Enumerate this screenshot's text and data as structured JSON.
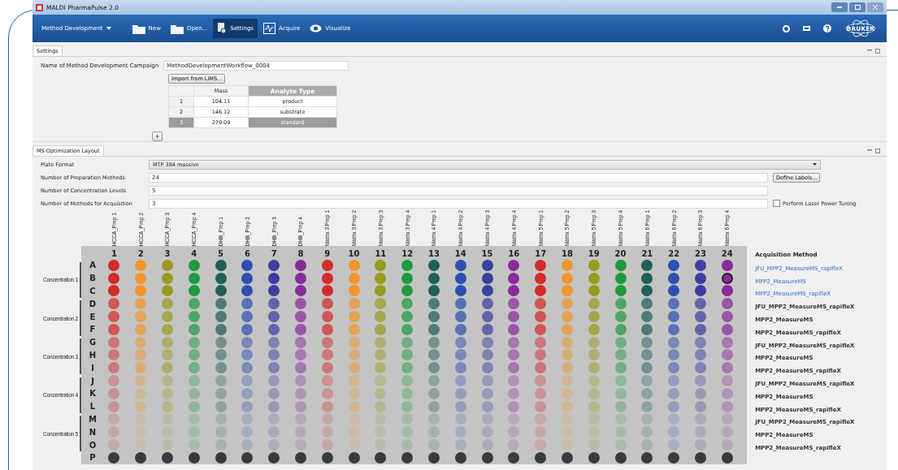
{
  "window": {
    "title": "MALDI PharmaPulse 2.0"
  },
  "toolbar": {
    "items": [
      {
        "label": "Method Development",
        "kind": "dropdown",
        "selected": false
      },
      {
        "label": "New",
        "kind": "folder-new",
        "selected": false
      },
      {
        "label": "Open...",
        "kind": "folder",
        "selected": false
      },
      {
        "label": "Settings",
        "kind": "settings",
        "selected": true
      },
      {
        "label": "Acquire",
        "kind": "acquire",
        "selected": false
      },
      {
        "label": "Visualize",
        "kind": "eye",
        "selected": false
      }
    ],
    "logo_text": "BRUKER"
  },
  "settings": {
    "tab": "Settings",
    "campaign_label": "Name of Method Development Campaign",
    "campaign_value": "MethodDevelopmentWorkflow_0004",
    "import_button": "Import from LIMS...",
    "add_button": "+",
    "analytes": {
      "columns": [
        "Mass",
        "Analyte Type"
      ],
      "rows": [
        {
          "index": "1",
          "mass": "104.11",
          "type": "product",
          "selected": false
        },
        {
          "index": "2",
          "mass": "146.12",
          "type": "substrate",
          "selected": false
        },
        {
          "index": "3",
          "mass": "279.09",
          "type": "standard",
          "selected": true
        }
      ]
    }
  },
  "layout": {
    "tab": "MS Optimization Layout",
    "plate_format_label": "Plate Format",
    "plate_format": "MTP 384 massive",
    "fields": [
      {
        "label": "Number of Preparation Methods",
        "value": "24"
      },
      {
        "label": "Number of Concentration Levels",
        "value": "5"
      },
      {
        "label": "Number of Methods for Acquisition",
        "value": "3"
      }
    ],
    "define_labels_button": "Define Labels...",
    "laser_tuning": {
      "label": "Perform Laser Power Tuning",
      "checked": false
    },
    "plate": {
      "method_heading": "Acquisition Method",
      "columns": [
        {
          "number": "1",
          "label": "HCCA_Prep 1",
          "color": "#d42a2a"
        },
        {
          "number": "2",
          "label": "HCCA_Prep 2",
          "color": "#f0962a"
        },
        {
          "number": "3",
          "label": "HCCA_Prep 3",
          "color": "#9a9a20"
        },
        {
          "number": "4",
          "label": "HCCA_Prep 4",
          "color": "#1f9a3f"
        },
        {
          "number": "5",
          "label": "DHB_Prep 1",
          "color": "#1f5f5a"
        },
        {
          "number": "6",
          "label": "DHB_Prep 2",
          "color": "#2e4fb0"
        },
        {
          "number": "7",
          "label": "DHB_Prep 3",
          "color": "#3a3fa0"
        },
        {
          "number": "8",
          "label": "DHB_Prep 4",
          "color": "#8a2a9a"
        },
        {
          "number": "9",
          "label": "Matrix 3 Prep 1",
          "color": "#d42a2a"
        },
        {
          "number": "10",
          "label": "Matrix 3 Prep 2",
          "color": "#f0962a"
        },
        {
          "number": "11",
          "label": "Matrix 3 Prep 3",
          "color": "#9a9a20"
        },
        {
          "number": "12",
          "label": "Matrix 3 Prep 4",
          "color": "#1f9a3f"
        },
        {
          "number": "13",
          "label": "Matrix 4 Prep 1",
          "color": "#1f5f5a"
        },
        {
          "number": "14",
          "label": "Matrix 4 Prep 2",
          "color": "#2e4fb0"
        },
        {
          "number": "15",
          "label": "Matrix 4 Prep 3",
          "color": "#3a3fa0"
        },
        {
          "number": "16",
          "label": "Matrix 4 Prep 4",
          "color": "#8a2a9a"
        },
        {
          "number": "17",
          "label": "Matrix 5 Prep 1",
          "color": "#d42a2a"
        },
        {
          "number": "18",
          "label": "Matrix 5 Prep 2",
          "color": "#f0962a"
        },
        {
          "number": "19",
          "label": "Matrix 5 Prep 3",
          "color": "#9a9a20"
        },
        {
          "number": "20",
          "label": "Matrix 5 Prep 4",
          "color": "#1f9a3f"
        },
        {
          "number": "21",
          "label": "Matrix 6 Prep 1",
          "color": "#1f5f5a"
        },
        {
          "number": "22",
          "label": "Matrix 6 Prep 2",
          "color": "#2e4fb0"
        },
        {
          "number": "23",
          "label": "Matrix 6 Prep 3",
          "color": "#3a3fa0"
        },
        {
          "number": "24",
          "label": "Matrix 6 Prep 4",
          "color": "#8a2a9a",
          "selected": true
        }
      ],
      "groups": [
        {
          "label": "Concentration 1",
          "rows": [
            {
              "letter": "A",
              "method": "JFU_MPP2_MeasureMS_rapifleX",
              "highlighted": true
            },
            {
              "letter": "B",
              "method": "MPP2_MeasureMS",
              "highlighted": true,
              "selected": true
            },
            {
              "letter": "C",
              "method": "MPP2_MeasureMS_rapifleX",
              "highlighted": true
            }
          ]
        },
        {
          "label": "Concentration 2",
          "rows": [
            {
              "letter": "D",
              "method": "JFU_MPP2_MeasureMS_rapifleX",
              "highlighted": false
            },
            {
              "letter": "E",
              "method": "MPP2_MeasureMS",
              "highlighted": false
            },
            {
              "letter": "F",
              "method": "MPP2_MeasureMS_rapifleX",
              "highlighted": false
            }
          ]
        },
        {
          "label": "Concentration 3",
          "rows": [
            {
              "letter": "G",
              "method": "JFU_MPP2_MeasureMS_rapifleX",
              "highlighted": false
            },
            {
              "letter": "H",
              "method": "MPP2_MeasureMS",
              "highlighted": false
            },
            {
              "letter": "I",
              "method": "MPP2_MeasureMS_rapifleX",
              "highlighted": false
            }
          ]
        },
        {
          "label": "Concentration 4",
          "rows": [
            {
              "letter": "J",
              "method": "JFU_MPP2_MeasureMS_rapifleX",
              "highlighted": false
            },
            {
              "letter": "K",
              "method": "MPP2_MeasureMS",
              "highlighted": false
            },
            {
              "letter": "L",
              "method": "MPP2_MeasureMS_rapifleX",
              "highlighted": false
            }
          ]
        },
        {
          "label": "Concentration 5",
          "rows": [
            {
              "letter": "M",
              "method": "JFU_MPP2_MeasureMS_rapifleX",
              "highlighted": false
            },
            {
              "letter": "N",
              "method": "MPP2_MeasureMS",
              "highlighted": false
            },
            {
              "letter": "O",
              "method": "MPP2_MeasureMS_rapifleX",
              "highlighted": false
            }
          ]
        }
      ],
      "unused_row": {
        "letter": "P"
      }
    }
  }
}
